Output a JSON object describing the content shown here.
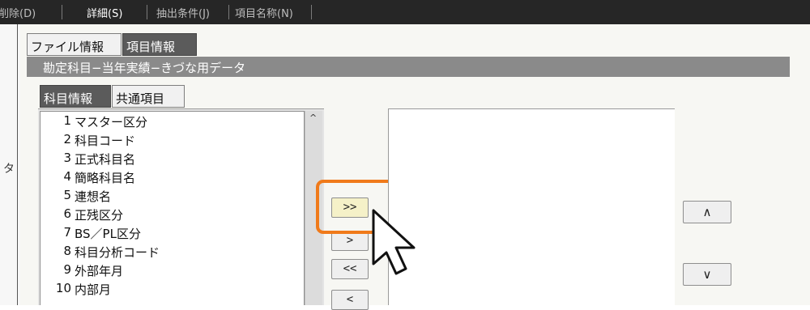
{
  "menubar": {
    "items": [
      {
        "label": "削除(D)",
        "active": false
      },
      {
        "label": "詳細(S)",
        "active": true
      },
      {
        "label": "抽出条件(J)",
        "active": false
      },
      {
        "label": "項目名称(N)",
        "active": false
      }
    ]
  },
  "left_band": {
    "glyph": "タ"
  },
  "outer_tabs": {
    "file_info": "ファイル情報",
    "item_info": "項目情報"
  },
  "panel_title": "勘定科目−当年実績−きづな用データ",
  "inner_tabs": {
    "subject_info": "科目情報",
    "common_items": "共通項目"
  },
  "item_list": [
    {
      "num": "1",
      "label": "マスター区分"
    },
    {
      "num": "2",
      "label": "科目コード"
    },
    {
      "num": "3",
      "label": "正式科目名"
    },
    {
      "num": "4",
      "label": "簡略科目名"
    },
    {
      "num": "5",
      "label": "連想名"
    },
    {
      "num": "6",
      "label": "正残区分"
    },
    {
      "num": "7",
      "label": "BS／PL区分"
    },
    {
      "num": "8",
      "label": "科目分析コード"
    },
    {
      "num": "9",
      "label": "外部年月"
    },
    {
      "num": "10",
      "label": "内部月"
    }
  ],
  "scroll_up_glyph": "^",
  "transfer_buttons": {
    "add_all": ">>",
    "add_one": ">",
    "remove_all": "<<",
    "remove_one": "<"
  },
  "order_buttons": {
    "move_up": "∧",
    "move_down": "∨"
  },
  "colors": {
    "menubar_bg": "#262626",
    "highlight": "#f07a1a",
    "selected_tab": "#5b5b5b",
    "title_bar": "#8a8a8a"
  }
}
